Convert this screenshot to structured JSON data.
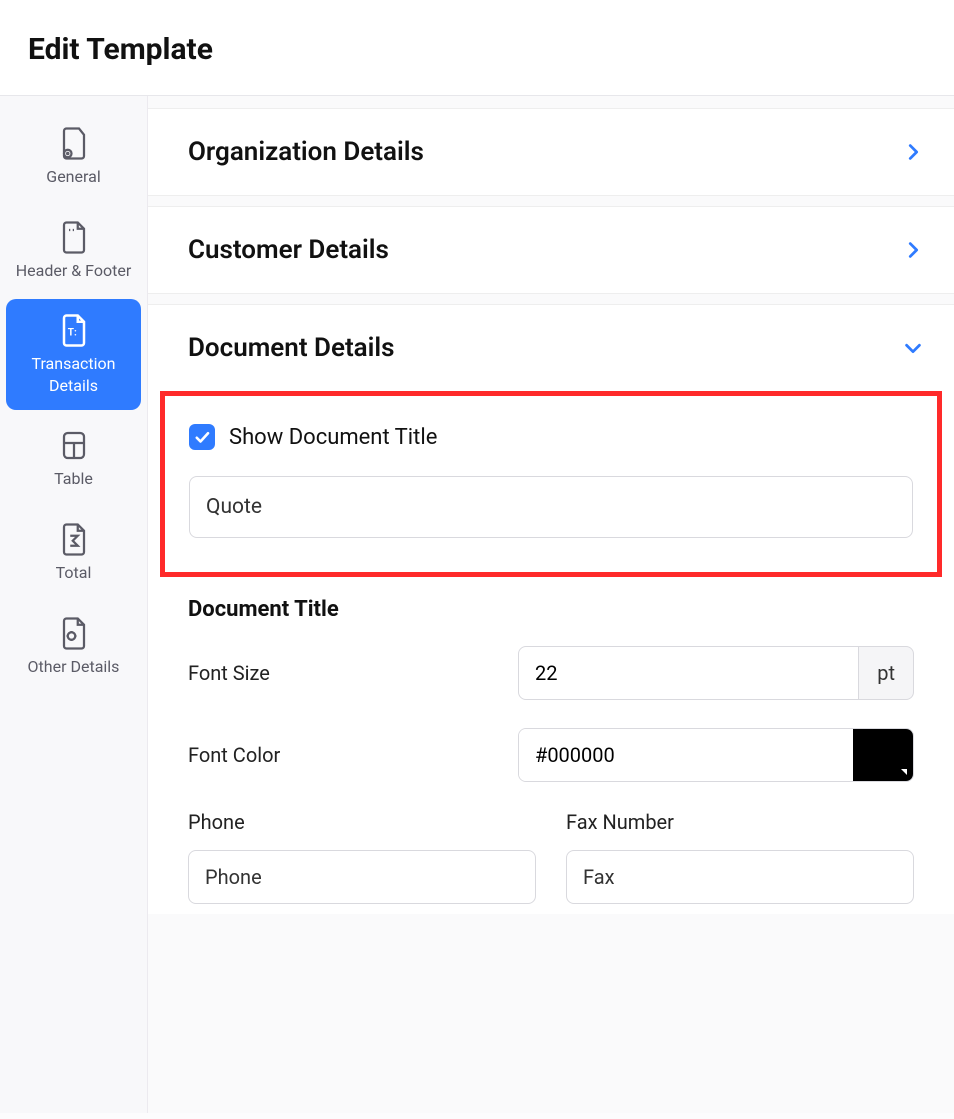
{
  "header": {
    "title": "Edit Template"
  },
  "sidebar": {
    "items": [
      {
        "label": "General"
      },
      {
        "label": "Header & Footer"
      },
      {
        "label": "Transaction Details"
      },
      {
        "label": "Table"
      },
      {
        "label": "Total"
      },
      {
        "label": "Other Details"
      }
    ]
  },
  "panels": {
    "organization": {
      "title": "Organization Details"
    },
    "customer": {
      "title": "Customer Details"
    },
    "document": {
      "title": "Document Details",
      "show_title_label": "Show Document Title",
      "title_input_value": "Quote",
      "subheading": "Document Title",
      "font_size": {
        "label": "Font Size",
        "value": "22",
        "unit": "pt"
      },
      "font_color": {
        "label": "Font Color",
        "value": "#000000",
        "swatch": "#000000"
      },
      "phone": {
        "label": "Phone",
        "value": "Phone"
      },
      "fax": {
        "label": "Fax Number",
        "value": "Fax"
      }
    }
  }
}
